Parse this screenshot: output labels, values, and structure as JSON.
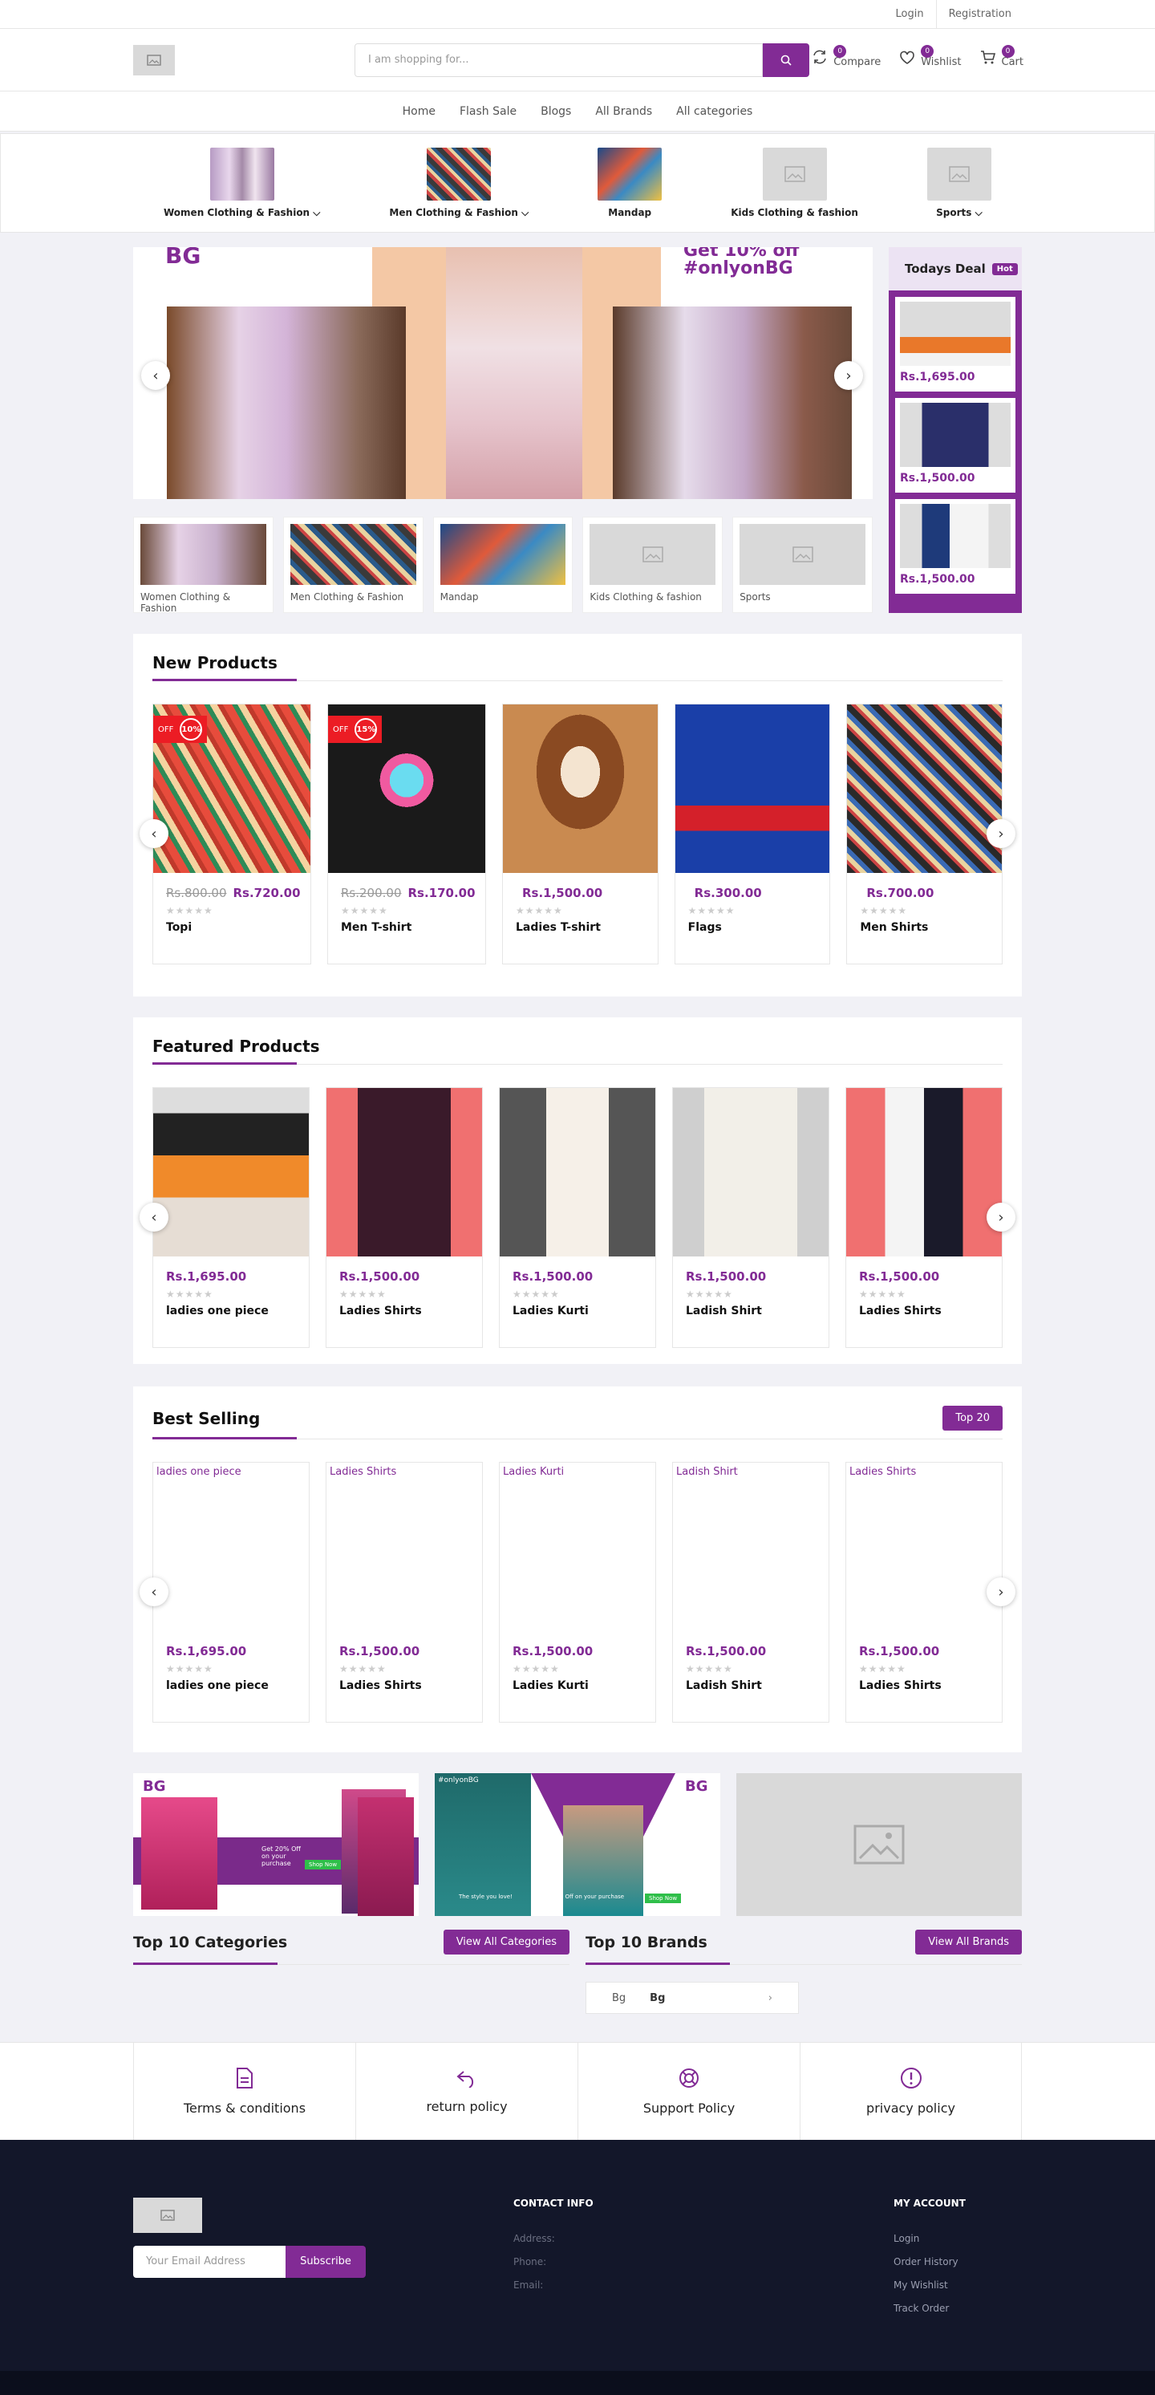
{
  "topbar": {
    "login": "Login",
    "registration": "Registration"
  },
  "header": {
    "search_placeholder": "I am shopping for...",
    "compare": {
      "label": "Compare",
      "count": "0"
    },
    "wishlist": {
      "label": "Wishlist",
      "count": "0"
    },
    "cart": {
      "label": "Cart",
      "count": "0"
    }
  },
  "nav": [
    "Home",
    "Flash Sale",
    "Blogs",
    "All Brands",
    "All categories"
  ],
  "catbar": [
    {
      "label": "Women Clothing & Fashion",
      "caret": "⌵"
    },
    {
      "label": "Men Clothing & Fashion",
      "caret": "⌵"
    },
    {
      "label": "Mandap",
      "caret": ""
    },
    {
      "label": "Kids Clothing & fashion",
      "caret": ""
    },
    {
      "label": "Sports",
      "caret": "⌵"
    }
  ],
  "hero": {
    "top_text": "Get 10% off",
    "hashtag": "#onlyonBG",
    "logo": "BG"
  },
  "todays_deal": {
    "title": "Todays Deal",
    "hot": "Hot",
    "items": [
      {
        "price": "Rs.1,695.00"
      },
      {
        "price": "Rs.1,500.00"
      },
      {
        "price": "Rs.1,500.00"
      }
    ]
  },
  "mini_categories": [
    "Women Clothing & Fashion",
    "Men Clothing & Fashion",
    "Mandap",
    "Kids Clothing & fashion",
    "Sports"
  ],
  "new_products": {
    "title": "New Products",
    "items": [
      {
        "old": "Rs.800.00",
        "price": "Rs.720.00",
        "name": "Topi",
        "off": "OFF",
        "pct": "10%"
      },
      {
        "old": "Rs.200.00",
        "price": "Rs.170.00",
        "name": "Men T-shirt",
        "off": "OFF",
        "pct": "15%"
      },
      {
        "old": "",
        "price": "Rs.1,500.00",
        "name": "Ladies T-shirt",
        "off": "",
        "pct": ""
      },
      {
        "old": "",
        "price": "Rs.300.00",
        "name": "Flags",
        "off": "",
        "pct": ""
      },
      {
        "old": "",
        "price": "Rs.700.00",
        "name": "Men Shirts",
        "off": "",
        "pct": ""
      }
    ]
  },
  "featured": {
    "title": "Featured Products",
    "items": [
      {
        "price": "Rs.1,695.00",
        "name": "ladies one piece"
      },
      {
        "price": "Rs.1,500.00",
        "name": "Ladies Shirts"
      },
      {
        "price": "Rs.1,500.00",
        "name": "Ladies Kurti"
      },
      {
        "price": "Rs.1,500.00",
        "name": "Ladish Shirt"
      },
      {
        "price": "Rs.1,500.00",
        "name": "Ladies Shirts"
      }
    ]
  },
  "best_selling": {
    "title": "Best Selling",
    "button": "Top 20",
    "items": [
      {
        "alt": "ladies one piece",
        "price": "Rs.1,695.00",
        "name": "ladies one piece"
      },
      {
        "alt": "Ladies Shirts",
        "price": "Rs.1,500.00",
        "name": "Ladies Shirts"
      },
      {
        "alt": "Ladies Kurti",
        "price": "Rs.1,500.00",
        "name": "Ladies Kurti"
      },
      {
        "alt": "Ladish Shirt",
        "price": "Rs.1,500.00",
        "name": "Ladish Shirt"
      },
      {
        "alt": "Ladies Shirts",
        "price": "Rs.1,500.00",
        "name": "Ladies Shirts"
      }
    ]
  },
  "banners": {
    "b1": {
      "logo": "BG",
      "text": "Get 20% Off on your purchase",
      "btn": "Shop Now"
    },
    "b2": {
      "tag": "#onlyonBG",
      "logo": "BG",
      "left": "The style you love!",
      "mid": "Get 10% Off on your purchase",
      "btn": "Shop Now"
    }
  },
  "top_categories": {
    "title": "Top 10 Categories",
    "button": "View All Categories"
  },
  "top_brands": {
    "title": "Top 10 Brands",
    "button": "View All Brands",
    "brand_alt": "Bg",
    "brand_name": "Bg"
  },
  "policies": [
    "Terms & conditions",
    "return policy",
    "Support Policy",
    "privacy policy"
  ],
  "footer": {
    "newsletter_placeholder": "Your Email Address",
    "subscribe": "Subscribe",
    "contact_title": "CONTACT INFO",
    "address": "Address:",
    "phone": "Phone:",
    "email": "Email:",
    "account_title": "MY ACCOUNT",
    "account_links": [
      "Login",
      "Order History",
      "My Wishlist",
      "Track Order"
    ]
  },
  "stars": "★★★★★",
  "colors": {
    "accent": "#822b95",
    "footer": "#13172a",
    "discount": "#ec1c24"
  }
}
